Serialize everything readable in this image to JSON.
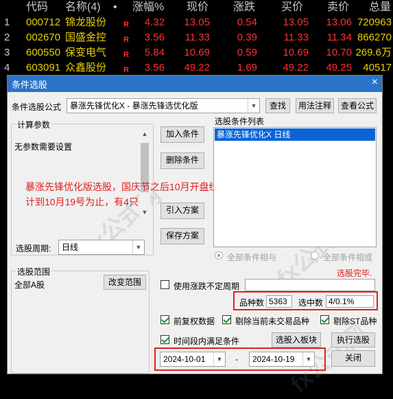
{
  "table": {
    "headers": {
      "code": "代码",
      "name": "名称(4)",
      "dot": "•",
      "pct": "涨幅%",
      "price": "现价",
      "chg": "涨跌",
      "bid": "买价",
      "ask": "卖价",
      "vol": "总量"
    },
    "rows": [
      {
        "idx": "1",
        "code": "000712",
        "name": "锦龙股份",
        "flag": "R",
        "pct": "4.32",
        "price": "13.05",
        "chg": "0.54",
        "bid": "13.05",
        "ask": "13.06",
        "vol": "720963"
      },
      {
        "idx": "2",
        "code": "002670",
        "name": "国盛金控",
        "flag": "R",
        "pct": "3.56",
        "price": "11.33",
        "chg": "0.39",
        "bid": "11.33",
        "ask": "11.34",
        "vol": "866270"
      },
      {
        "idx": "3",
        "code": "600550",
        "name": "保变电气",
        "flag": "R",
        "pct": "5.84",
        "price": "10.69",
        "chg": "0.59",
        "bid": "10.69",
        "ask": "10.70",
        "vol": "269.6万"
      },
      {
        "idx": "4",
        "code": "603091",
        "name": "众鑫股份",
        "flag": "R",
        "pct": "3.56",
        "price": "49.22",
        "chg": "1.69",
        "bid": "49.22",
        "ask": "49.25",
        "vol": "40517"
      }
    ]
  },
  "dialog": {
    "title": "条件选股",
    "close": "×",
    "formula_label": "条件选股公式",
    "formula_value": "暴涨先锋优化X  -  暴涨先锋选优化版",
    "btn_find": "查找",
    "btn_usage": "用法注释",
    "btn_view": "查看公式",
    "params_group": "计算参数",
    "params_text": "无参数需要设置",
    "annotation_line1": "暴涨先锋优化版选股，国庆节之后10月开盘统",
    "annotation_line2": "计到10月19号为止，有4只",
    "btn_add": "加入条件",
    "btn_delete": "删除条件",
    "btn_import": "引入方案",
    "btn_save": "保存方案",
    "cond_list_label": "选股条件列表",
    "cond_item": "暴涨先锋优化X  日线",
    "period_label": "选股周期:",
    "period_value": "日线",
    "radio_and": "全部条件相与",
    "radio_or": "全部条件相或",
    "status": "选股完毕.",
    "range_group": "选股范围",
    "range_value": "全部A股",
    "btn_change_range": "改变范围",
    "chk_uncertain": "使用涨跌不定周期",
    "count_label": "品种数",
    "count_value": "5363",
    "selected_label": "选中数",
    "selected_value": "4/0.1%",
    "chk_adjust": "前复权数据",
    "chk_exclude_untraded": "剔除当前未交易品种",
    "chk_exclude_st": "剔除ST品种",
    "chk_period": "时间段内满足条件",
    "btn_to_block": "选股入板块",
    "btn_execute": "执行选股",
    "date_from": "2024-10-01",
    "date_sep": "-",
    "date_to": "2024-10-19",
    "btn_close": "关闭"
  }
}
